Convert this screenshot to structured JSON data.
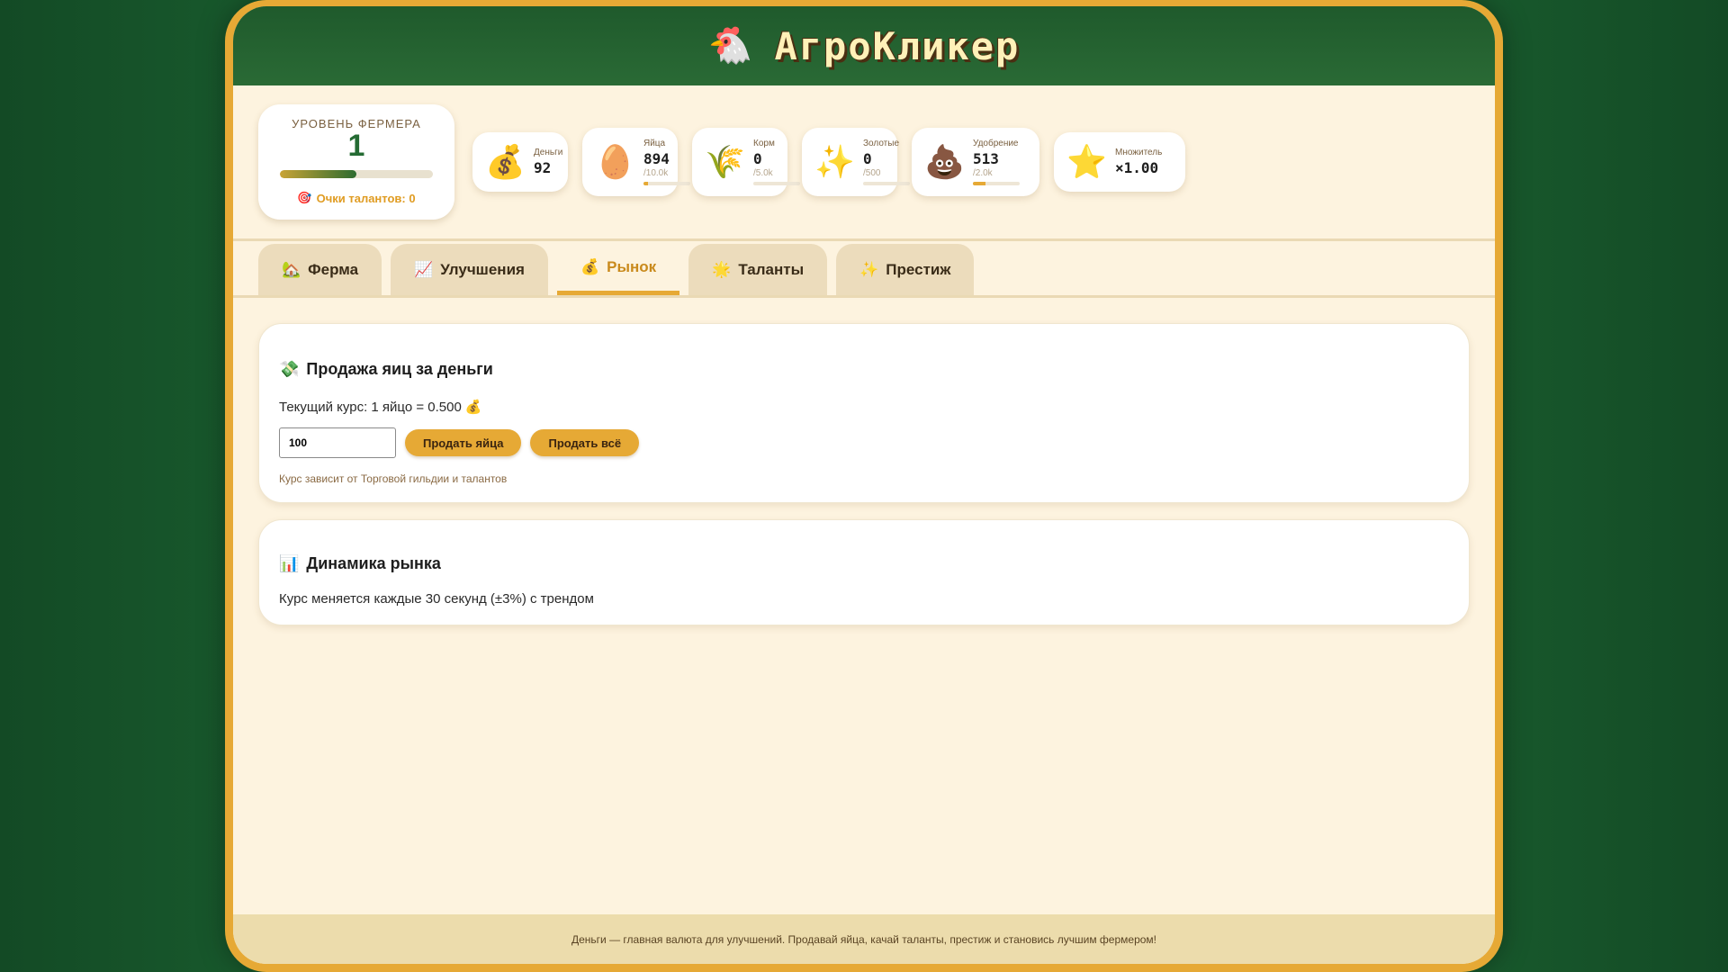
{
  "app": {
    "title": "АгроКликер",
    "logo_icon": "🐔"
  },
  "level": {
    "label": "УРОВЕНЬ ФЕРМЕРА",
    "value": "1",
    "progress": 0.5,
    "talent_icon": "🎯",
    "talent_points": "Очки талантов: 0"
  },
  "stats": [
    {
      "id": "money",
      "icon": "💰",
      "name": "Деньги",
      "value": "92"
    },
    {
      "id": "eggs",
      "icon": "🥚",
      "name": "Яйца",
      "value": "894",
      "max": "/10.0k",
      "progress": 0.09
    },
    {
      "id": "feed",
      "icon": "🌾",
      "name": "Корм",
      "value": "0",
      "max": "/5.0k",
      "progress": 0
    },
    {
      "id": "gold",
      "icon": "✨",
      "name": "Золотые",
      "value": "0",
      "max": "/500",
      "progress": 0
    },
    {
      "id": "fertilizer",
      "icon": "💩",
      "name": "Удобрение",
      "value": "513",
      "max": "/2.0k",
      "progress": 0.26
    },
    {
      "id": "multiplier",
      "icon": "⭐",
      "name": "Множитель",
      "value": "×1.00"
    }
  ],
  "tabs": [
    {
      "id": "farm",
      "icon": "🏡",
      "label": "Ферма"
    },
    {
      "id": "upgrades",
      "icon": "📈",
      "label": "Улучшения"
    },
    {
      "id": "market",
      "icon": "💰",
      "label": "Рынок",
      "active": true
    },
    {
      "id": "talents",
      "icon": "🌟",
      "label": "Таланты"
    },
    {
      "id": "prestige",
      "icon": "✨",
      "label": "Престиж"
    }
  ],
  "sell": {
    "icon": "💸",
    "title": "Продажа яиц за деньги",
    "rate_text": "Текущий курс: 1 яйцо = 0.500",
    "rate_icon": "💰",
    "input_value": "100",
    "sell_button": "Продать яйца",
    "sell_all_button": "Продать всё",
    "hint": "Курс зависит от Торговой гильдии и талантов"
  },
  "dynamics": {
    "icon": "📊",
    "title": "Динамика рынка",
    "text": "Курс меняется каждые 30 секунд (±3%) с трендом"
  },
  "footer": {
    "text": "Деньги — главная валюта для улучшений. Продавай яйца, качай таланты, престиж и становись лучшим фермером!"
  }
}
